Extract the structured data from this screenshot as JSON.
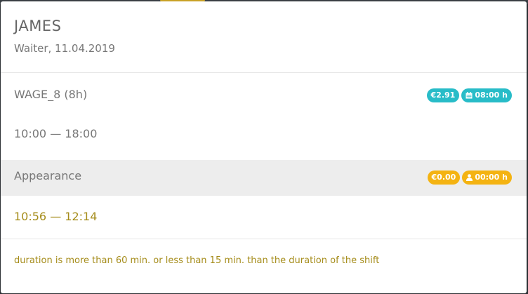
{
  "employee": {
    "name": "JAMES",
    "subtitle": "Waiter, 11.04.2019"
  },
  "wage": {
    "title": "WAGE_8 (8h)",
    "time_range": "10:00 — 18:00",
    "badges": [
      {
        "text": "€2.91",
        "icon": "none",
        "color": "#28bcc8"
      },
      {
        "text": "08:00 h",
        "icon": "calendar-icon",
        "color": "#28bcc8"
      }
    ]
  },
  "appearance": {
    "title": "Appearance",
    "time_range": "10:56 — 12:14",
    "badges": [
      {
        "text": "€0.00",
        "icon": "none",
        "color": "#f4b312"
      },
      {
        "text": "00:00 h",
        "icon": "user-icon",
        "color": "#f4b312"
      }
    ]
  },
  "warning": {
    "text": "duration is more than 60 min. or less than 15 min. than the duration of the shift",
    "color": "#a58c1a"
  }
}
